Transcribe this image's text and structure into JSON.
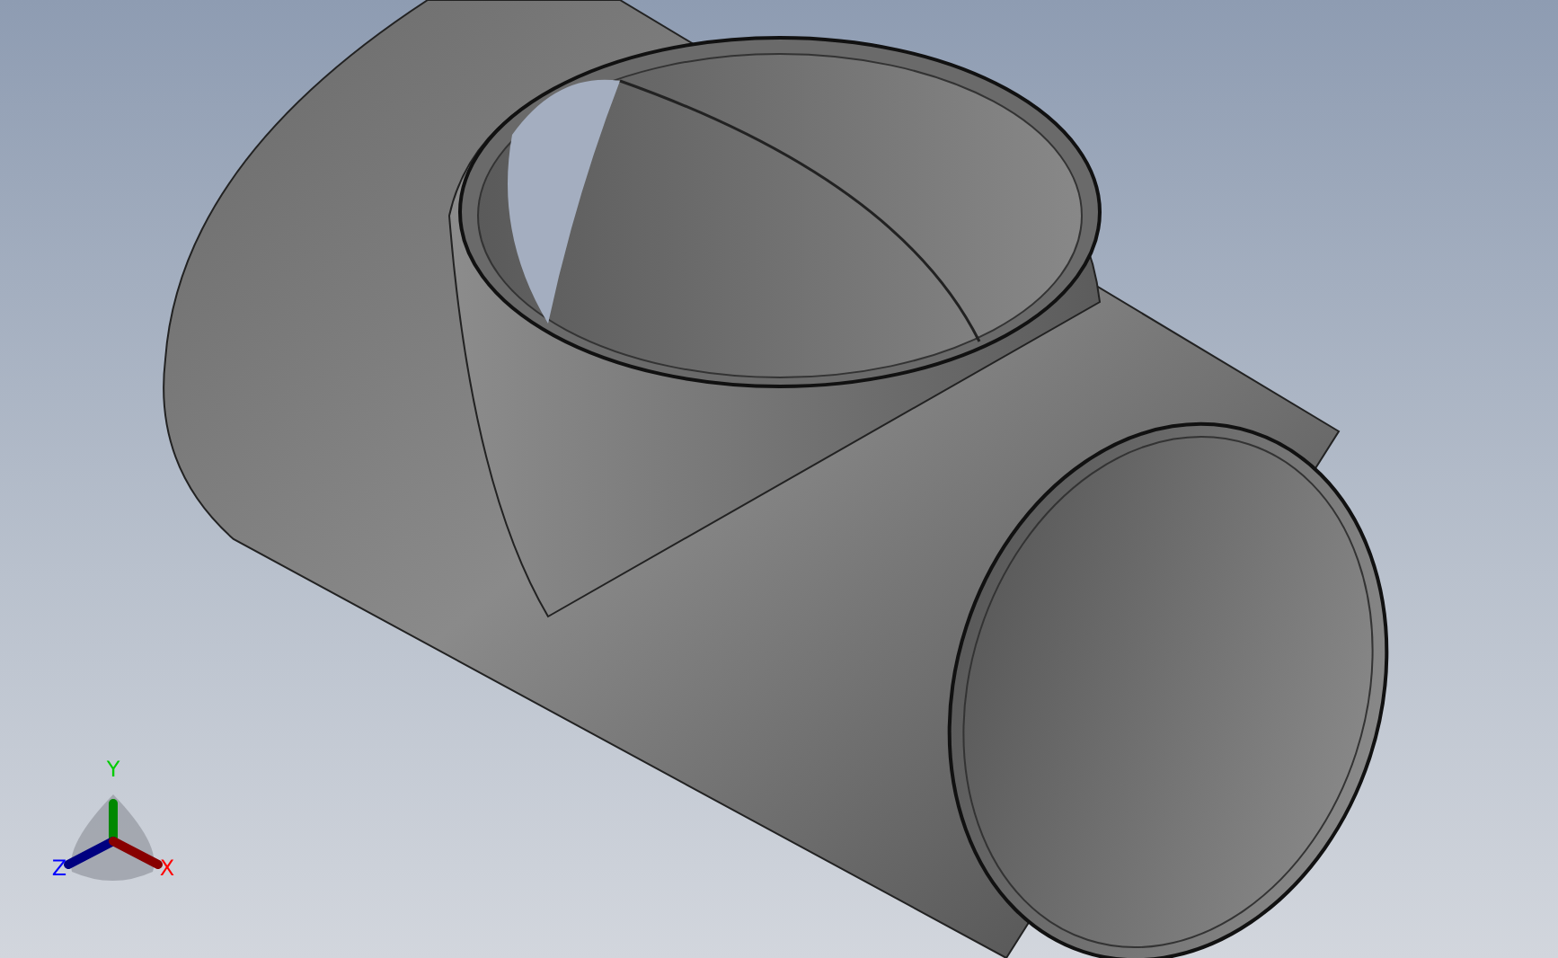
{
  "viewport": {
    "triad": {
      "axes": [
        {
          "label": "Y",
          "color": "#00cc00"
        },
        {
          "label": "Z",
          "color": "#0000ff"
        },
        {
          "label": "X",
          "color": "#ff0000"
        }
      ]
    }
  }
}
